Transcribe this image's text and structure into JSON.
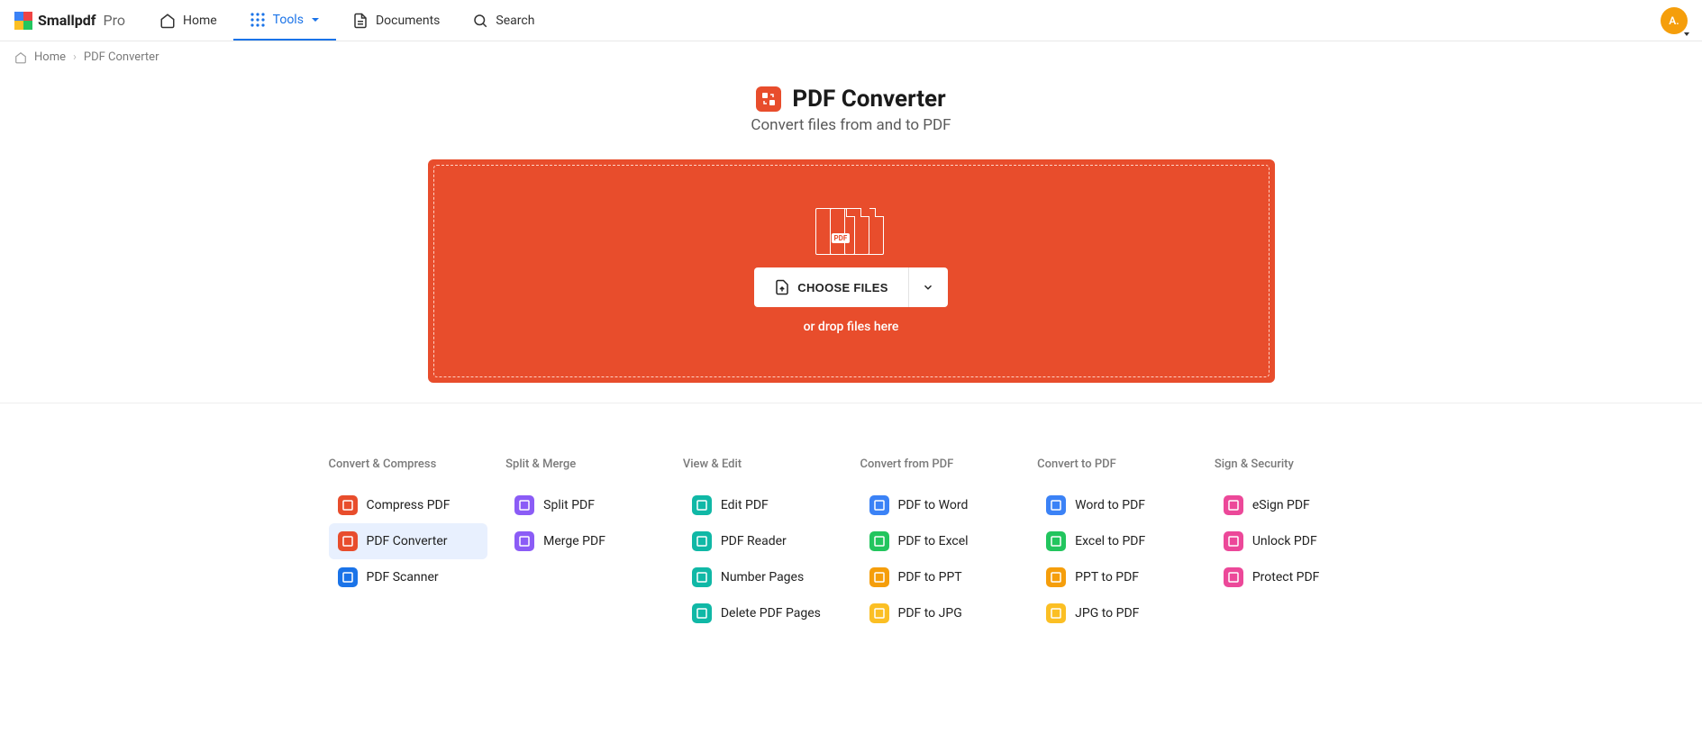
{
  "brand": {
    "name": "Smallpdf",
    "tier": "Pro"
  },
  "nav": {
    "home": "Home",
    "tools": "Tools",
    "documents": "Documents",
    "search": "Search"
  },
  "avatar": {
    "initials": "A."
  },
  "breadcrumb": {
    "home": "Home",
    "current": "PDF Converter"
  },
  "hero": {
    "title": "PDF Converter",
    "subtitle": "Convert files from and to PDF",
    "choose_label": "CHOOSE FILES",
    "drop_hint": "or drop files here",
    "pdf_badge": "PDF"
  },
  "tool_groups": [
    {
      "heading": "Convert & Compress",
      "items": [
        {
          "label": "Compress PDF",
          "color": "#e84d2c",
          "active": false
        },
        {
          "label": "PDF Converter",
          "color": "#e84d2c",
          "active": true
        },
        {
          "label": "PDF Scanner",
          "color": "#1a73e8",
          "active": false
        }
      ]
    },
    {
      "heading": "Split & Merge",
      "items": [
        {
          "label": "Split PDF",
          "color": "#8b5cf6",
          "active": false
        },
        {
          "label": "Merge PDF",
          "color": "#8b5cf6",
          "active": false
        }
      ]
    },
    {
      "heading": "View & Edit",
      "items": [
        {
          "label": "Edit PDF",
          "color": "#10b8a6",
          "active": false
        },
        {
          "label": "PDF Reader",
          "color": "#10b8a6",
          "active": false
        },
        {
          "label": "Number Pages",
          "color": "#10b8a6",
          "active": false
        },
        {
          "label": "Delete PDF Pages",
          "color": "#10b8a6",
          "active": false
        }
      ]
    },
    {
      "heading": "Convert from PDF",
      "items": [
        {
          "label": "PDF to Word",
          "color": "#3b82f6",
          "active": false
        },
        {
          "label": "PDF to Excel",
          "color": "#22c55e",
          "active": false
        },
        {
          "label": "PDF to PPT",
          "color": "#f59e0b",
          "active": false
        },
        {
          "label": "PDF to JPG",
          "color": "#fbbf24",
          "active": false
        }
      ]
    },
    {
      "heading": "Convert to PDF",
      "items": [
        {
          "label": "Word to PDF",
          "color": "#3b82f6",
          "active": false
        },
        {
          "label": "Excel to PDF",
          "color": "#22c55e",
          "active": false
        },
        {
          "label": "PPT to PDF",
          "color": "#f59e0b",
          "active": false
        },
        {
          "label": "JPG to PDF",
          "color": "#fbbf24",
          "active": false
        }
      ]
    },
    {
      "heading": "Sign & Security",
      "items": [
        {
          "label": "eSign PDF",
          "color": "#ec4899",
          "active": false
        },
        {
          "label": "Unlock PDF",
          "color": "#ec4899",
          "active": false
        },
        {
          "label": "Protect PDF",
          "color": "#ec4899",
          "active": false
        }
      ]
    }
  ]
}
